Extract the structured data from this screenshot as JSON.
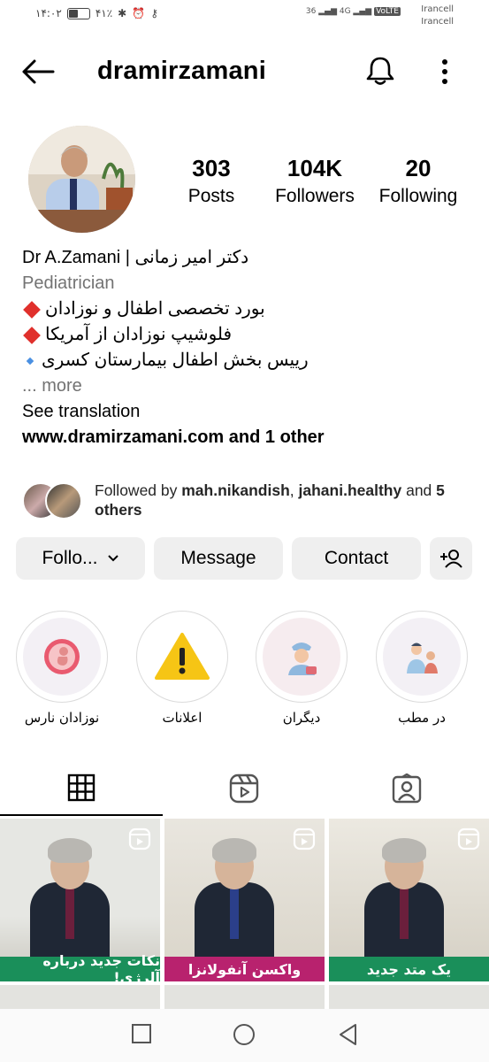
{
  "status": {
    "time": "۱۴:۰۲",
    "battery": "۴۱٪",
    "network1": "36",
    "network2": "4G",
    "volte": "VoLTE",
    "carrier1": "Irancell",
    "carrier2": "Irancell"
  },
  "header": {
    "username": "dramirzamani"
  },
  "stats": [
    {
      "num": "303",
      "label": "Posts"
    },
    {
      "num": "104K",
      "label": "Followers"
    },
    {
      "num": "20",
      "label": "Following"
    }
  ],
  "bio": {
    "name": "دکتر امیر زمانی | Dr A.Zamani",
    "category": "Pediatrician",
    "line1": "بورد تخصصی اطفال و نوزادان",
    "line2": "فلوشیپ نوزادان از آمریکا",
    "line3": "رییس بخش اطفال بیمارستان کسری",
    "more": "... more",
    "see_translation": "See translation",
    "link": "www.dramirzamani.com and 1 other"
  },
  "followed": {
    "prefix": "Followed by ",
    "user1": "mah.nikandish",
    "sep": ", ",
    "user2": "jahani.healthy",
    "and": " and ",
    "others": "5 others"
  },
  "buttons": {
    "following": "Follo...",
    "message": "Message",
    "contact": "Contact"
  },
  "highlights": [
    {
      "label": "نوزادان نارس",
      "icon": "fetus-icon"
    },
    {
      "label": "اعلانات",
      "icon": "warning-icon"
    },
    {
      "label": "دیگران",
      "icon": "nurse-icon"
    },
    {
      "label": "در مطب",
      "icon": "doctor-patient-icon"
    }
  ],
  "posts": [
    {
      "caption": "نکات جدید درباره آلرژی!",
      "bar_color": "#1a8f5a"
    },
    {
      "caption": "واکسن آنفولانزا",
      "bar_color": "#b8226e"
    },
    {
      "caption": "یک متد جدید",
      "bar_color": "#1a8f5a"
    }
  ],
  "colors": {
    "text_secondary": "#737373",
    "button_bg": "#efefef",
    "diamond_red": "#e0302c"
  }
}
